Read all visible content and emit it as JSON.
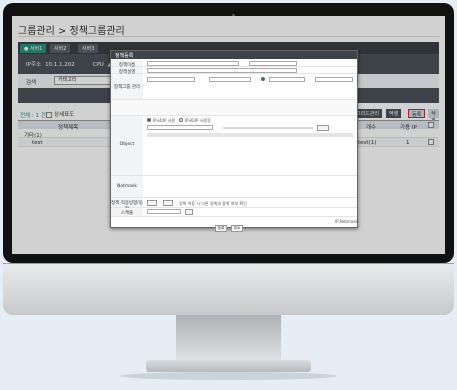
{
  "page": {
    "title": "그룹관리 > 정책그룹관리"
  },
  "tabs": [
    {
      "label": "● 서버1"
    },
    {
      "label": "서버2"
    },
    {
      "label": "서버3"
    }
  ],
  "server_info": {
    "ip_label": "IP주소",
    "ip_value": "10.1.1.202",
    "cpu_label": "CPU",
    "cpu_value": "▲"
  },
  "search": {
    "label": "검색",
    "selected": "카테고리"
  },
  "toolbar": {
    "count": "전체 : 1 건",
    "detail_label": "상세표도",
    "buttons": [
      "그리드관리",
      "엑셀",
      "등록",
      "삭제"
    ]
  },
  "table": {
    "headers": [
      "정책제목",
      "개수",
      "가용 IP"
    ],
    "rows": [
      {
        "name": "기타(1)",
        "extra": "",
        "count": ""
      },
      {
        "name": "test",
        "extra": "test(1)",
        "count": "1"
      }
    ]
  },
  "modal": {
    "title": "정책등록",
    "row_labels": [
      "정책이름",
      "정책설명",
      "",
      "정책그룹 관리",
      "",
      "Object",
      "",
      "Netmask",
      "정책 적용방향/동작",
      "스케줄"
    ],
    "radio_labels": [
      "IPv4/IP 사용",
      "IPv6/IP 사용함"
    ],
    "note": "정책 적용 시 다른 정책과 중복 여부 확인",
    "buttons": [
      "등록",
      "취소"
    ],
    "footer_link": "IP Netmask"
  }
}
